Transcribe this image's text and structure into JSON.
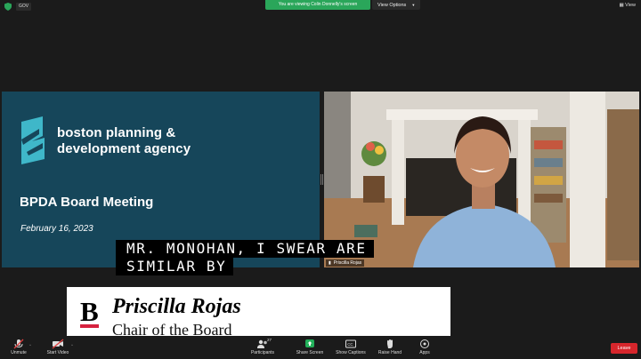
{
  "topbar": {
    "gov_badge": "GOV",
    "banner": "You are viewing Colin Donnelly's screen",
    "view_options": "View Options",
    "view": "View"
  },
  "slide": {
    "org_name": "boston planning &\ndevelopment agency",
    "meeting_title": "BPDA Board Meeting",
    "meeting_date": "February 16, 2023"
  },
  "video": {
    "participant_name": "Priscilla Rojas"
  },
  "captions": {
    "line1": "MR. MONOHAN, I SWEAR ARE",
    "line2": "SIMILAR BY"
  },
  "lower_third": {
    "logo_letter": "B",
    "name": "Priscilla Rojas",
    "title": "Chair of the Board",
    "accent_color": "#d6213f"
  },
  "toolbar": {
    "unmute": "Unmute",
    "start_video": "Start Video",
    "participants": "Participants",
    "participants_count": "27",
    "share_screen": "Share Screen",
    "show_captions": "Show Captions",
    "raise_hand": "Raise Hand",
    "apps": "Apps",
    "leave": "Leave"
  }
}
